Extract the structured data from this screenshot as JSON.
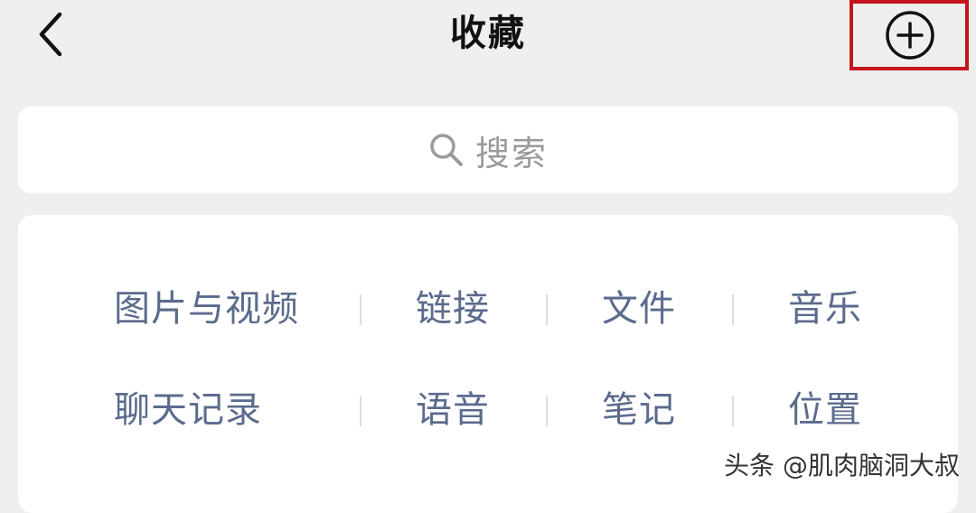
{
  "header": {
    "title": "收藏",
    "back_icon": "chevron-left-icon",
    "add_icon": "plus-circle-icon"
  },
  "search": {
    "placeholder": "搜索",
    "icon": "search-icon"
  },
  "categories": {
    "rows": [
      [
        "图片与视频",
        "链接",
        "文件",
        "音乐"
      ],
      [
        "聊天记录",
        "语音",
        "笔记",
        "位置"
      ]
    ]
  },
  "watermark": {
    "text": "头条 @肌肉脑洞大叔"
  },
  "colors": {
    "background": "#efefef",
    "card": "#ffffff",
    "category_text": "#5b6b8c",
    "highlight_box": "#c4141c"
  }
}
